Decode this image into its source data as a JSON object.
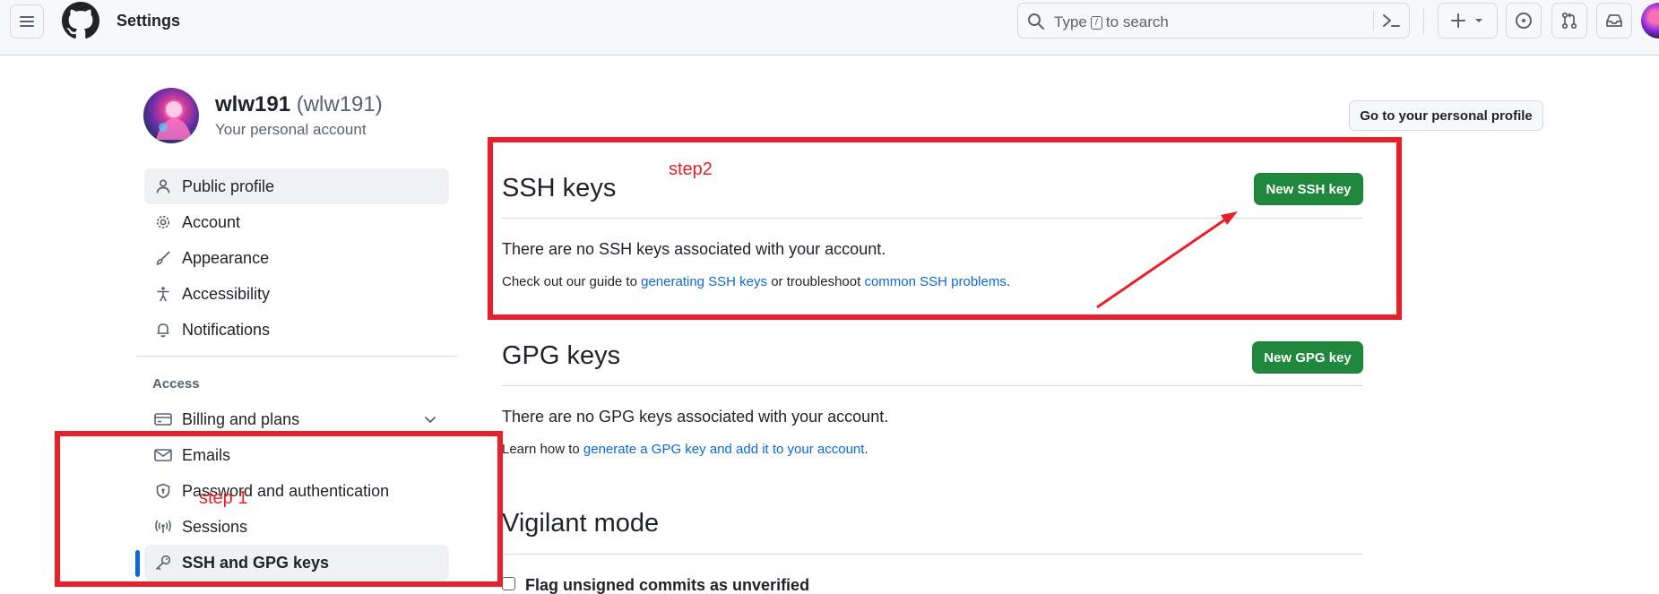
{
  "header": {
    "title": "Settings",
    "search": {
      "placeholder_before": "Type",
      "placeholder_key": "/",
      "placeholder_after": "to search"
    }
  },
  "account": {
    "name": "wlw191",
    "handle": "(wlw191)",
    "subtitle": "Your personal account",
    "profile_button": "Go to your personal profile"
  },
  "sidebar": {
    "items": [
      {
        "label": "Public profile",
        "icon": "person-icon"
      },
      {
        "label": "Account",
        "icon": "gear-icon"
      },
      {
        "label": "Appearance",
        "icon": "paintbrush-icon"
      },
      {
        "label": "Accessibility",
        "icon": "accessibility-icon"
      },
      {
        "label": "Notifications",
        "icon": "bell-icon"
      }
    ],
    "access_heading": "Access",
    "access_items": [
      {
        "label": "Billing and plans",
        "icon": "credit-card-icon"
      },
      {
        "label": "Emails",
        "icon": "mail-icon"
      },
      {
        "label": "Password and authentication",
        "icon": "shield-lock-icon"
      },
      {
        "label": "Sessions",
        "icon": "broadcast-icon"
      },
      {
        "label": "SSH and GPG keys",
        "icon": "key-icon"
      }
    ]
  },
  "ssh": {
    "title": "SSH keys",
    "button": "New SSH key",
    "empty": "There are no SSH keys associated with your account.",
    "guide_prefix": "Check out our guide to",
    "guide_link": "generating SSH keys",
    "guide_middle": "or troubleshoot",
    "guide_link2": "common SSH problems",
    "guide_suffix": "."
  },
  "gpg": {
    "title": "GPG keys",
    "button": "New GPG key",
    "empty": "There are no GPG keys associated with your account.",
    "learn_prefix": "Learn how to",
    "learn_link": "generate a GPG key and add it to your account",
    "learn_suffix": "."
  },
  "vigilant": {
    "title": "Vigilant mode",
    "checkbox_label": "Flag unsigned commits as unverified",
    "checked": false
  },
  "annotations": {
    "step1": "step 1",
    "step2": "step2",
    "color": "#e8202a"
  },
  "colors": {
    "accent": "#0969da",
    "primary_button": "#1f883d"
  }
}
